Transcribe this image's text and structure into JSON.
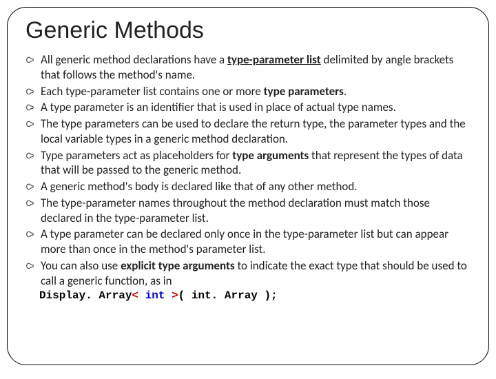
{
  "title": "Generic Methods",
  "bullets": [
    {
      "segments": [
        {
          "t": "All generic method declarations have a "
        },
        {
          "t": "type-parameter list",
          "bold": true,
          "underline": true
        },
        {
          "t": " delimited by angle brackets that follows the method's name."
        }
      ]
    },
    {
      "segments": [
        {
          "t": "Each type-parameter list contains one or more "
        },
        {
          "t": "type parameters",
          "bold": true
        },
        {
          "t": "."
        }
      ]
    },
    {
      "segments": [
        {
          "t": "A type parameter is an identifier that is used in place of actual type names."
        }
      ]
    },
    {
      "segments": [
        {
          "t": "The type parameters can be used to declare the return type, the parameter types and the local variable types in a generic method declaration."
        }
      ]
    },
    {
      "segments": [
        {
          "t": "Type parameters act as placeholders for "
        },
        {
          "t": "type arguments",
          "bold": true
        },
        {
          "t": " that represent the types of data that will be passed to the generic method."
        }
      ]
    },
    {
      "segments": [
        {
          "t": "A generic method's body is declared like that of any other method."
        }
      ]
    },
    {
      "segments": [
        {
          "t": "The type-parameter names throughout the method declaration must match those declared in the type-parameter list."
        }
      ]
    },
    {
      "segments": [
        {
          "t": "A type parameter can be declared only once in the type-parameter list but can appear more than once in the method's parameter list."
        }
      ]
    },
    {
      "segments": [
        {
          "t": "You can also use "
        },
        {
          "t": "explicit type arguments",
          "bold": true
        },
        {
          "t": " to indicate the exact type that should be used to call a generic function, as in"
        }
      ]
    }
  ],
  "code": {
    "tokens": [
      {
        "t": "Display. Array",
        "c": "blk"
      },
      {
        "t": "<",
        "c": "red"
      },
      {
        "t": " ",
        "c": "blk"
      },
      {
        "t": "int",
        "c": "blu"
      },
      {
        "t": " ",
        "c": "blk"
      },
      {
        "t": ">",
        "c": "red"
      },
      {
        "t": "( int. Array );",
        "c": "blk"
      }
    ]
  }
}
